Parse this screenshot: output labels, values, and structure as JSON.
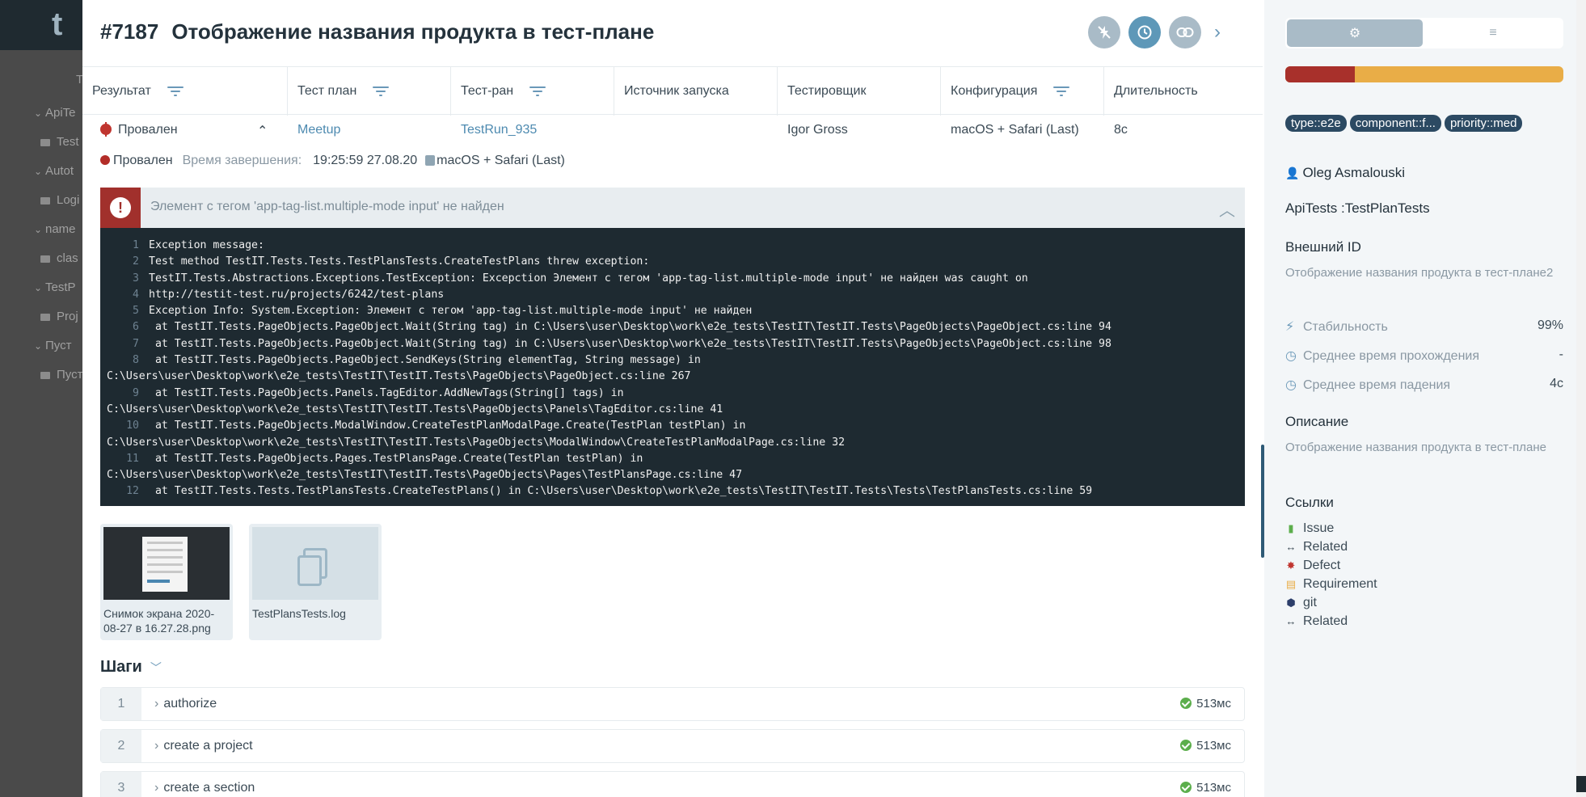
{
  "background_app": {
    "logo_char": "t",
    "tab_partial": "T",
    "tree_items": [
      {
        "chev": "⌄",
        "label": "ApiTe",
        "folder": false
      },
      {
        "chev": "",
        "label": "Test",
        "folder": true
      },
      {
        "chev": "⌄",
        "label": "Autot",
        "folder": false
      },
      {
        "chev": "",
        "label": "Logi",
        "folder": true
      },
      {
        "chev": "⌄",
        "label": "name",
        "folder": false
      },
      {
        "chev": "",
        "label": "clas",
        "folder": true
      },
      {
        "chev": "⌄",
        "label": "TestP",
        "folder": false
      },
      {
        "chev": "",
        "label": "Proj",
        "folder": true
      },
      {
        "chev": "⌄",
        "label": "Пуст",
        "folder": false
      },
      {
        "chev": "",
        "label": "Пуст",
        "folder": true
      }
    ]
  },
  "header": {
    "id": "#7187",
    "title": "Отображение названия продукта в тест-плане"
  },
  "table": {
    "columns": [
      "Результат",
      "Тест план",
      "Тест-ран",
      "Источник запуска",
      "Тестировщик",
      "Конфигурация",
      "Длительность"
    ],
    "row": {
      "result": "Провален",
      "test_plan": "Meetup",
      "test_run": "TestRun_935",
      "source": "",
      "tester": "Igor Gross",
      "configuration": "macOS + Safari (Last)",
      "duration": "8c"
    }
  },
  "status_line": {
    "status": "Провален",
    "finished_label": "Время завершения:",
    "finished_value": "19:25:59 27.08.20",
    "configuration": "macOS + Safari (Last)"
  },
  "error": {
    "message": "Элемент с тегом 'app-tag-list.multiple-mode input' не найден"
  },
  "code_lines": [
    {
      "n": "1",
      "text": "Exception message:",
      "cont": ""
    },
    {
      "n": "2",
      "text": "Test method TestIT.Tests.Tests.TestPlansTests.CreateTestPlans threw exception:",
      "cont": ""
    },
    {
      "n": "3",
      "text": "TestIT.Tests.Abstractions.Exceptions.TestException: Excepction Элемент с тегом 'app-tag-list.multiple-mode input' не найден was caught on",
      "cont": ""
    },
    {
      "n": "4",
      "text": "http://testit-test.ru/projects/6242/test-plans",
      "cont": ""
    },
    {
      "n": "5",
      "text": "Exception Info: System.Exception: Элемент с тегом 'app-tag-list.multiple-mode input' не найден",
      "cont": ""
    },
    {
      "n": "6",
      "text": " at TestIT.Tests.PageObjects.PageObject.Wait(String tag) in C:\\Users\\user\\Desktop\\work\\e2e_tests\\TestIT\\TestIT.Tests\\PageObjects\\PageObject.cs:line 94",
      "cont": ""
    },
    {
      "n": "7",
      "text": " at TestIT.Tests.PageObjects.PageObject.Wait(String tag) in C:\\Users\\user\\Desktop\\work\\e2e_tests\\TestIT\\TestIT.Tests\\PageObjects\\PageObject.cs:line 98",
      "cont": ""
    },
    {
      "n": "8",
      "text": " at TestIT.Tests.PageObjects.PageObject.SendKeys(String elementTag, String message) in",
      "cont": "C:\\Users\\user\\Desktop\\work\\e2e_tests\\TestIT\\TestIT.Tests\\PageObjects\\PageObject.cs:line 267"
    },
    {
      "n": "9",
      "text": " at TestIT.Tests.PageObjects.Panels.TagEditor.AddNewTags(String[] tags) in",
      "cont": "C:\\Users\\user\\Desktop\\work\\e2e_tests\\TestIT\\TestIT.Tests\\PageObjects\\Panels\\TagEditor.cs:line 41"
    },
    {
      "n": "10",
      "text": " at TestIT.Tests.PageObjects.ModalWindow.CreateTestPlanModalPage.Create(TestPlan testPlan) in",
      "cont": "C:\\Users\\user\\Desktop\\work\\e2e_tests\\TestIT\\TestIT.Tests\\PageObjects\\ModalWindow\\CreateTestPlanModalPage.cs:line 32"
    },
    {
      "n": "11",
      "text": " at TestIT.Tests.PageObjects.Pages.TestPlansPage.Create(TestPlan testPlan) in",
      "cont": "C:\\Users\\user\\Desktop\\work\\e2e_tests\\TestIT\\TestIT.Tests\\PageObjects\\Pages\\TestPlansPage.cs:line 47"
    },
    {
      "n": "12",
      "text": " at TestIT.Tests.Tests.TestPlansTests.CreateTestPlans() in C:\\Users\\user\\Desktop\\work\\e2e_tests\\TestIT\\TestIT.Tests\\Tests\\TestPlansTests.cs:line 59",
      "cont": ""
    }
  ],
  "attachments": [
    {
      "name": "Снимок экрана 2020-08-27 в 16.27.28.png",
      "kind": "image"
    },
    {
      "name": "TestPlansTests.log",
      "kind": "file"
    }
  ],
  "steps": {
    "title": "Шаги",
    "items": [
      {
        "n": "1",
        "label": "authorize",
        "duration": "513мс"
      },
      {
        "n": "2",
        "label": "create a project",
        "duration": "513мс"
      },
      {
        "n": "3",
        "label": "create a section",
        "duration": "513мс"
      }
    ]
  },
  "side": {
    "progress_failed_fraction": 0.25,
    "colors": {
      "failed": "#a8302b",
      "passed": "#e9ad47",
      "tag": "#2c4a63"
    },
    "tags": [
      "type::e2e",
      "component::f...",
      "priority::med"
    ],
    "author": "Oleg Asmalouski",
    "class_path": "ApiTests :TestPlanTests",
    "external_id_label": "Внешний ID",
    "external_id_value": "Отображение названия продукта в тест-плане2",
    "stats": [
      {
        "label": "Стабильность",
        "value": "99%",
        "icon": "bolt-icon"
      },
      {
        "label": "Среднее время прохождения",
        "value": "-",
        "icon": "clock-icon"
      },
      {
        "label": "Среднее время падения",
        "value": "4c",
        "icon": "clock-icon"
      }
    ],
    "description_label": "Описание",
    "description_value": "Отображение названия продукта в тест-плане",
    "links_label": "Ссылки",
    "links": [
      {
        "label": "Issue",
        "icon": "bookmark-icon"
      },
      {
        "label": "Related",
        "icon": "arrows-icon"
      },
      {
        "label": "Defect",
        "icon": "bug-icon"
      },
      {
        "label": "Requirement",
        "icon": "requirement-icon"
      },
      {
        "label": "git",
        "icon": "cube-icon"
      },
      {
        "label": "Related",
        "icon": "arrows-icon"
      }
    ]
  }
}
